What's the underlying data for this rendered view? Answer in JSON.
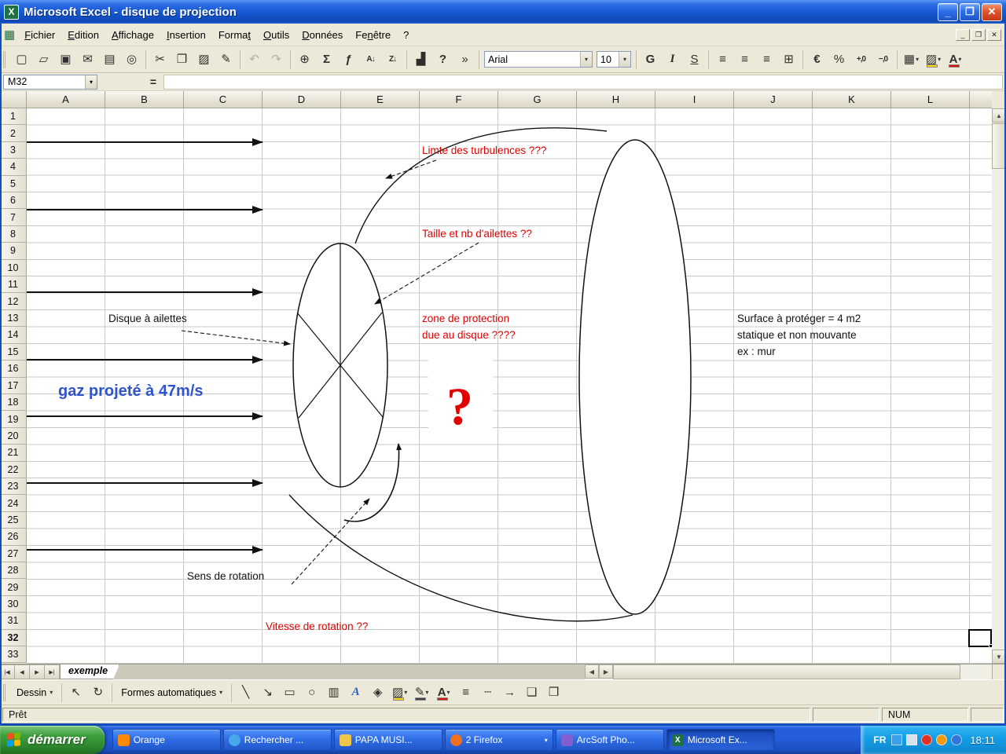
{
  "window": {
    "title": "Microsoft Excel - disque de projection"
  },
  "menu": {
    "items": [
      {
        "id": "fichier",
        "label": "Fichier",
        "u": 0
      },
      {
        "id": "edition",
        "label": "Edition",
        "u": 0
      },
      {
        "id": "affichage",
        "label": "Affichage",
        "u": 0
      },
      {
        "id": "insertion",
        "label": "Insertion",
        "u": 0
      },
      {
        "id": "format",
        "label": "Format",
        "u": 5
      },
      {
        "id": "outils",
        "label": "Outils",
        "u": 0
      },
      {
        "id": "donnees",
        "label": "Données",
        "u": 0
      },
      {
        "id": "fenetre",
        "label": "Fenêtre",
        "u": 2
      },
      {
        "id": "aide",
        "label": "?",
        "u": -1
      }
    ]
  },
  "toolbar": {
    "font_name": "Arial",
    "font_size": "10",
    "items": [
      {
        "t": "i",
        "n": "new-workbook-icon",
        "g": "▢"
      },
      {
        "t": "i",
        "n": "open-icon",
        "g": "▱"
      },
      {
        "t": "i",
        "n": "save-icon",
        "g": "▣"
      },
      {
        "t": "i",
        "n": "mail-icon",
        "g": "✉"
      },
      {
        "t": "i",
        "n": "print-icon",
        "g": "▤"
      },
      {
        "t": "i",
        "n": "print-preview-icon",
        "g": "◎"
      },
      {
        "t": "s"
      },
      {
        "t": "i",
        "n": "cut-icon",
        "g": "✂"
      },
      {
        "t": "i",
        "n": "copy-icon",
        "g": "❐"
      },
      {
        "t": "i",
        "n": "paste-icon",
        "g": "▨"
      },
      {
        "t": "i",
        "n": "format-painter-icon",
        "g": "✎"
      },
      {
        "t": "s"
      },
      {
        "t": "i",
        "n": "undo-icon",
        "g": "↶",
        "dis": 1
      },
      {
        "t": "i",
        "n": "redo-icon",
        "g": "↷",
        "dis": 1
      },
      {
        "t": "s"
      },
      {
        "t": "i",
        "n": "insert-hyperlink-icon",
        "g": "⊕"
      },
      {
        "t": "i",
        "n": "autosum-icon",
        "g": "Σ",
        "b": 1
      },
      {
        "t": "i",
        "n": "paste-function-icon",
        "g": "ƒ",
        "b": 1
      },
      {
        "t": "i",
        "n": "sort-ascending-icon",
        "g": "A↓",
        "sm": 1
      },
      {
        "t": "i",
        "n": "sort-descending-icon",
        "g": "Z↓",
        "sm": 1
      },
      {
        "t": "s"
      },
      {
        "t": "i",
        "n": "chart-wizard-icon",
        "g": "▟"
      },
      {
        "t": "i",
        "n": "help-icon",
        "g": "?",
        "b": 1
      },
      {
        "t": "i",
        "n": "toolbar-options-chevron",
        "g": "»"
      },
      {
        "t": "s"
      },
      {
        "t": "combo",
        "n": "font-name-select",
        "bind": "font_name",
        "w": 138
      },
      {
        "t": "combo",
        "n": "font-size-select",
        "bind": "font_size",
        "w": 44
      },
      {
        "t": "s"
      },
      {
        "t": "i",
        "n": "bold-button",
        "g": "G",
        "b": 1
      },
      {
        "t": "i",
        "n": "italic-button",
        "g": "I",
        "it": 1
      },
      {
        "t": "i",
        "n": "underline-button",
        "g": "S",
        "u": 1
      },
      {
        "t": "s"
      },
      {
        "t": "i",
        "n": "align-left-icon",
        "g": "≡"
      },
      {
        "t": "i",
        "n": "align-center-icon",
        "g": "≡"
      },
      {
        "t": "i",
        "n": "align-right-icon",
        "g": "≡"
      },
      {
        "t": "i",
        "n": "merge-center-icon",
        "g": "⊞"
      },
      {
        "t": "s"
      },
      {
        "t": "i",
        "n": "currency-euro-icon",
        "g": "€",
        "b": 1
      },
      {
        "t": "i",
        "n": "percent-style-icon",
        "g": "%"
      },
      {
        "t": "i",
        "n": "increase-decimal-icon",
        "g": "+,0",
        "sm": 1
      },
      {
        "t": "i",
        "n": "decrease-decimal-icon",
        "g": "−,0",
        "sm": 1
      },
      {
        "t": "s"
      },
      {
        "t": "i",
        "n": "borders-icon",
        "g": "▦",
        "dd": 1
      },
      {
        "t": "i",
        "n": "fill-color-icon",
        "g": "▨",
        "dd": 1,
        "bar": "#ffd400"
      },
      {
        "t": "i",
        "n": "font-color-icon",
        "g": "A",
        "dd": 1,
        "bar": "#dd1100",
        "b": 1
      }
    ]
  },
  "formula_bar": {
    "name_box": "M32",
    "equals": "="
  },
  "sheet": {
    "columns": [
      "A",
      "B",
      "C",
      "D",
      "E",
      "F",
      "G",
      "H",
      "I",
      "J",
      "K",
      "L"
    ],
    "rows": 33,
    "active_row": 32,
    "active_cell": "M32",
    "tab_label": "exemple",
    "nav": [
      "|◀",
      "◀",
      "▶",
      "▶|"
    ]
  },
  "drawing": {
    "labels": {
      "turbulence": "Limte des turbulences ???",
      "fins": "Taille et nb d'ailettes ??",
      "zone1": "zone de protection",
      "zone2": "due au disque  ????",
      "disc": "Disque à ailettes",
      "gas": "gaz projeté à 47m/s",
      "question": "?",
      "rotation": "Sens de rotation",
      "speed": "Vitesse de rotation ??",
      "surface1": "Surface à protéger =  4 m2",
      "surface2": "statique et non mouvante",
      "surface3": "ex : mur"
    },
    "colors": {
      "annotation_red": "#e00000",
      "gas_blue": "#2f55cc",
      "ink": "#111111"
    }
  },
  "drawing_toolbar": {
    "dessin_label": "Dessin",
    "autoshapes_label": "Formes automatiques",
    "group1": [
      {
        "n": "select-objects-icon",
        "g": "↖"
      },
      {
        "n": "free-rotate-icon",
        "g": "↻"
      }
    ],
    "group2": [
      {
        "n": "line-icon",
        "g": "╲"
      },
      {
        "n": "arrow-icon",
        "g": "↘"
      },
      {
        "n": "rectangle-icon",
        "g": "▭"
      },
      {
        "n": "oval-icon",
        "g": "○"
      },
      {
        "n": "text-box-icon",
        "g": "▥"
      },
      {
        "n": "wordart-icon",
        "g": "A",
        "wa": 1
      },
      {
        "n": "insert-diagram-icon",
        "g": "◈"
      },
      {
        "n": "fill-color-icon",
        "g": "▨",
        "dd": 1,
        "bar": "#ffd400"
      },
      {
        "n": "line-color-icon",
        "g": "✎",
        "dd": 1,
        "bar": "#404040"
      },
      {
        "n": "font-color-icon",
        "g": "A",
        "dd": 1,
        "bar": "#dd1100",
        "b": 1
      },
      {
        "n": "line-style-icon",
        "g": "≡"
      },
      {
        "n": "dash-style-icon",
        "g": "┄"
      },
      {
        "n": "arrow-style-icon",
        "g": "→"
      },
      {
        "n": "shadow-style-icon",
        "g": "❏"
      },
      {
        "n": "3d-style-icon",
        "g": "❒"
      }
    ]
  },
  "status_bar": {
    "ready": "Prêt",
    "num": "NUM"
  },
  "taskbar": {
    "start_label": "démarrer",
    "tasks": [
      {
        "label": "Orange",
        "icon": "orange-app-icon",
        "color": "#ff8a00",
        "shape": "square",
        "letter": ""
      },
      {
        "label": "Rechercher ...",
        "icon": "search-window-icon",
        "color": "#46a8e8",
        "shape": "circle",
        "letter": ""
      },
      {
        "label": "PAPA  MUSI...",
        "icon": "folder-icon",
        "color": "#f0c64a",
        "shape": "square",
        "letter": ""
      },
      {
        "label": "2 Firefox",
        "icon": "firefox-icon",
        "color": "#f07020",
        "shape": "circle",
        "letter": "",
        "grouped": true
      },
      {
        "label": "ArcSoft Pho...",
        "icon": "photo-app-icon",
        "color": "#8060d0",
        "shape": "square",
        "letter": ""
      },
      {
        "label": "Microsoft Ex...",
        "icon": "excel-icon",
        "color": "#1e7145",
        "shape": "square",
        "letter": "X",
        "active": true
      }
    ],
    "tray": {
      "language": "FR",
      "time": "18:11",
      "icons": [
        {
          "name": "messenger-tray-icon",
          "color": "#38a0e8",
          "shape": "square"
        },
        {
          "name": "display-tray-icon",
          "color": "#d8e0ec",
          "shape": "square"
        },
        {
          "name": "antivirus-tray-icon",
          "color": "#e03020",
          "shape": "circle"
        },
        {
          "name": "update-tray-icon",
          "color": "#f59a10",
          "shape": "circle"
        },
        {
          "name": "network-tray-icon",
          "color": "#2f78d8",
          "shape": "circle"
        }
      ]
    }
  },
  "flag_colors": [
    "#f25022",
    "#7fba00",
    "#00a4ef",
    "#ffb900"
  ]
}
